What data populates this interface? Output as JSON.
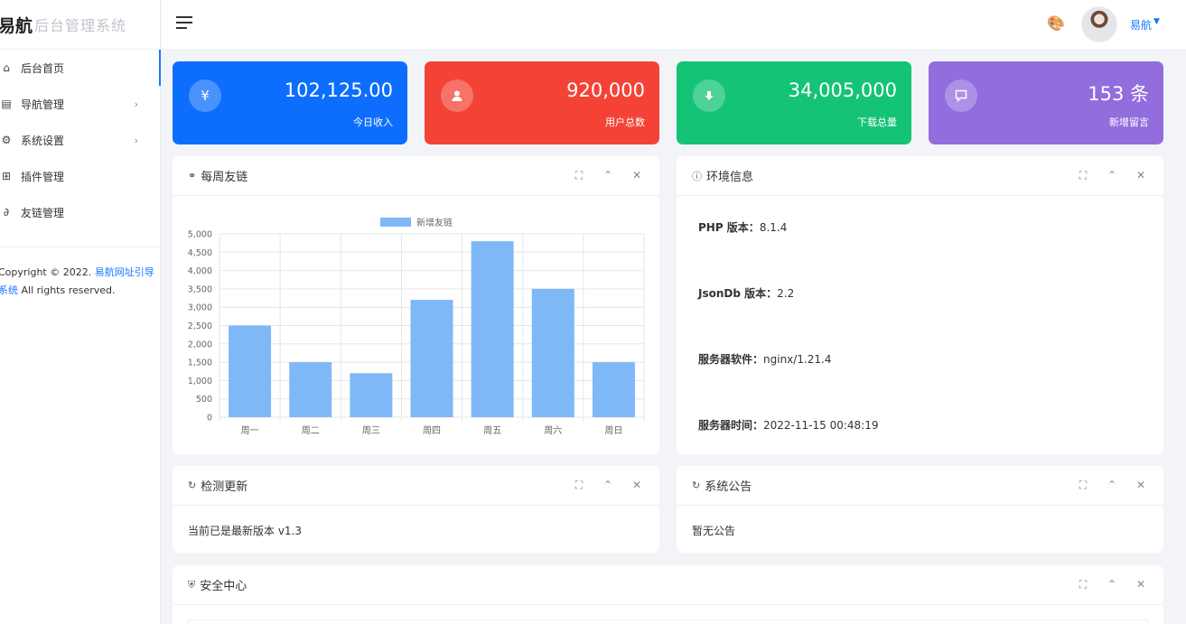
{
  "sidebar": {
    "brand": "易航",
    "brand_sub": "后台管理系统",
    "items": [
      {
        "label": "后台首页",
        "icon": "home-icon"
      },
      {
        "label": "导航管理",
        "icon": "nav-icon"
      },
      {
        "label": "系统设置",
        "icon": "gear-icon"
      },
      {
        "label": "插件管理",
        "icon": "plugin-icon"
      },
      {
        "label": "友链管理",
        "icon": "link-icon"
      }
    ],
    "copyright_prefix": "Copyright © 2022.",
    "copyright_link": "易航网址引导系统",
    "copyright_suffix": "All rights reserved."
  },
  "header": {
    "user_name": "易航"
  },
  "stats": [
    {
      "value": "102,125.00",
      "label": "今日收入",
      "icon": "yen-icon",
      "color": "#0d6efd"
    },
    {
      "value": "920,000",
      "label": "用户总数",
      "icon": "user-icon",
      "color": "#f44336"
    },
    {
      "value": "34,005,000",
      "label": "下载总量",
      "icon": "download-icon",
      "color": "#15c377"
    },
    {
      "value": "153 条",
      "label": "新增留言",
      "icon": "message-icon",
      "color": "#926dde"
    }
  ],
  "panels": {
    "links": {
      "title": "每周友链"
    },
    "env": {
      "title": "环境信息",
      "rows": [
        {
          "label": "PHP 版本：",
          "value": "8.1.4"
        },
        {
          "label": "JsonDb 版本：",
          "value": "2.2"
        },
        {
          "label": "服务器软件：",
          "value": "nginx/1.21.4"
        },
        {
          "label": "服务器时间：",
          "value": "2022-11-15 00:48:19"
        }
      ]
    },
    "update": {
      "title": "检测更新",
      "text": "当前已是最新版本 v1.3"
    },
    "notice": {
      "title": "系统公告",
      "text": "暂无公告"
    },
    "security": {
      "title": "安全中心"
    }
  },
  "chart_data": {
    "type": "bar",
    "categories": [
      "周一",
      "周二",
      "周三",
      "周四",
      "周五",
      "周六",
      "周日"
    ],
    "series": [
      {
        "name": "新增友链",
        "values": [
          2500,
          1500,
          1200,
          3200,
          4800,
          3500,
          1500
        ]
      }
    ],
    "ylim": [
      0,
      5000
    ],
    "yticks": [
      0,
      500,
      1000,
      1500,
      2000,
      2500,
      3000,
      3500,
      4000,
      4500,
      5000
    ],
    "ytick_labels": [
      "0",
      "500",
      "1,000",
      "1,500",
      "2,000",
      "2,500",
      "3,000",
      "3,500",
      "4,000",
      "4,500",
      "5,000"
    ],
    "grid": true,
    "legend": "top-center",
    "bar_color": "#7fb8f7"
  }
}
